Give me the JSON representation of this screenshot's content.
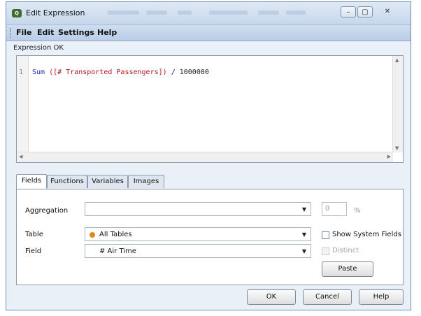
{
  "window": {
    "title": "Edit Expression",
    "controls": {
      "minimize": "–",
      "maximize": "▢",
      "close": "✕"
    }
  },
  "menu": [
    "File",
    "Edit",
    "Settings",
    "Help"
  ],
  "status": "Expression OK",
  "editor": {
    "line_number": "1",
    "code_fn": "Sum",
    "code_field": " ([# Transported Passengers])",
    "code_rest": " / 1000000"
  },
  "tabs": [
    "Fields",
    "Functions",
    "Variables",
    "Images"
  ],
  "active_tab": "Fields",
  "fields_panel": {
    "aggregation_label": "Aggregation",
    "aggregation_value": "",
    "percent_value": "0",
    "percent_unit": "%",
    "table_label": "Table",
    "table_value": "All Tables",
    "show_system_fields_label": "Show System Fields",
    "field_label": "Field",
    "field_value": "# Air Time",
    "distinct_label": "Distinct",
    "paste_label": "Paste"
  },
  "buttons": {
    "ok": "OK",
    "cancel": "Cancel",
    "help": "Help"
  },
  "colors": {
    "code_function": "#1c2fb3",
    "code_field": "#b21a1a",
    "table_dot": "#e08a12"
  }
}
